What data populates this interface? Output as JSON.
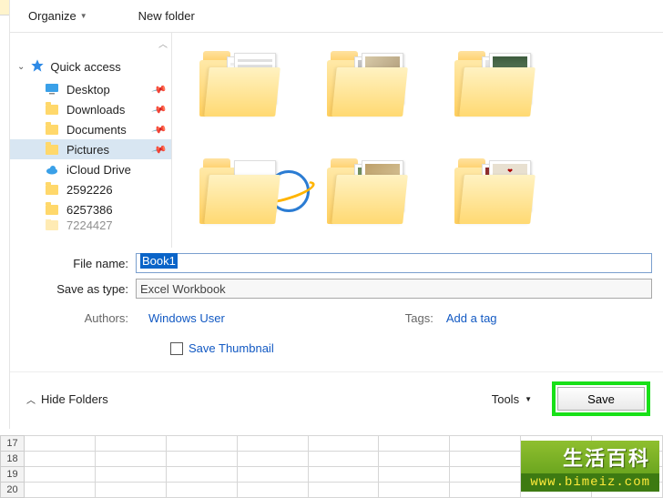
{
  "toolbar": {
    "organize": "Organize",
    "new_folder": "New folder"
  },
  "nav": {
    "quick_access": "Quick access",
    "items": [
      {
        "label": "Desktop",
        "pinned": true,
        "icon": "desktop"
      },
      {
        "label": "Downloads",
        "pinned": true,
        "icon": "folder"
      },
      {
        "label": "Documents",
        "pinned": true,
        "icon": "folder"
      },
      {
        "label": "Pictures",
        "pinned": true,
        "icon": "folder",
        "selected": true
      },
      {
        "label": "iCloud Drive",
        "pinned": false,
        "icon": "cloud"
      },
      {
        "label": "2592226",
        "pinned": false,
        "icon": "folder"
      },
      {
        "label": "6257386",
        "pinned": false,
        "icon": "folder"
      },
      {
        "label": "7224427",
        "pinned": false,
        "icon": "folder"
      }
    ]
  },
  "fields": {
    "file_name_label": "File name:",
    "file_name_value": "Book1",
    "save_as_type_label": "Save as type:",
    "save_as_type_value": "Excel Workbook",
    "authors_label": "Authors:",
    "authors_value": "Windows User",
    "tags_label": "Tags:",
    "tags_value": "Add a tag",
    "save_thumbnail": "Save Thumbnail"
  },
  "footer": {
    "hide_folders": "Hide Folders",
    "tools": "Tools",
    "save": "Save"
  },
  "sheet_rows": [
    "17",
    "18",
    "19",
    "20"
  ],
  "watermark": {
    "title": "生活百科",
    "url": "www.bimeiz.com"
  }
}
